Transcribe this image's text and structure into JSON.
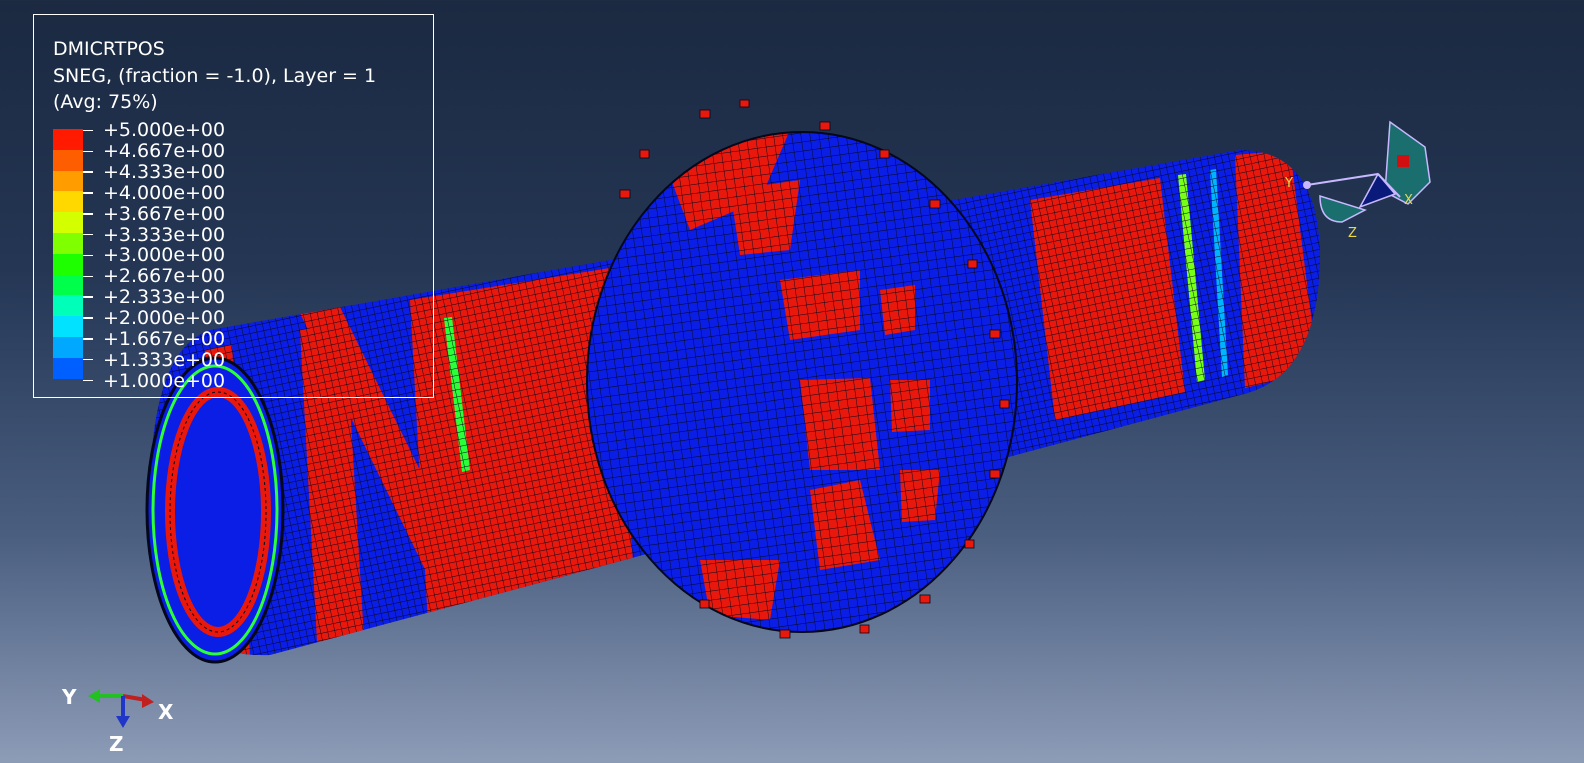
{
  "legend": {
    "variable": "DMICRTPOS",
    "section": "SNEG, (fraction = -1.0), Layer = 1",
    "averaging": "(Avg: 75%)",
    "levels": [
      {
        "label": "+5.000e+00",
        "color": "#ff1a00"
      },
      {
        "label": "+4.667e+00",
        "color": "#ff5e00"
      },
      {
        "label": "+4.333e+00",
        "color": "#ff9d00"
      },
      {
        "label": "+4.000e+00",
        "color": "#ffd800"
      },
      {
        "label": "+3.667e+00",
        "color": "#d4ff00"
      },
      {
        "label": "+3.333e+00",
        "color": "#7fff00"
      },
      {
        "label": "+3.000e+00",
        "color": "#1eff00"
      },
      {
        "label": "+2.667e+00",
        "color": "#00ff4a"
      },
      {
        "label": "+2.333e+00",
        "color": "#00ffb8"
      },
      {
        "label": "+2.000e+00",
        "color": "#00e2ff"
      },
      {
        "label": "+1.667e+00",
        "color": "#00a8ff"
      },
      {
        "label": "+1.333e+00",
        "color": "#0060ff"
      },
      {
        "label": "+1.000e+00",
        "color": "#0000ff"
      }
    ]
  },
  "view_triad": {
    "y_label": "Y",
    "x_label": "X",
    "z_label": "Z"
  },
  "axis_triad": {
    "y_label": "Y",
    "x_label": "X",
    "z_label": "Z"
  },
  "colors": {
    "mesh_blue": "#0a1ee6",
    "mesh_red": "#e8180c",
    "mesh_lines": "#05071a"
  }
}
